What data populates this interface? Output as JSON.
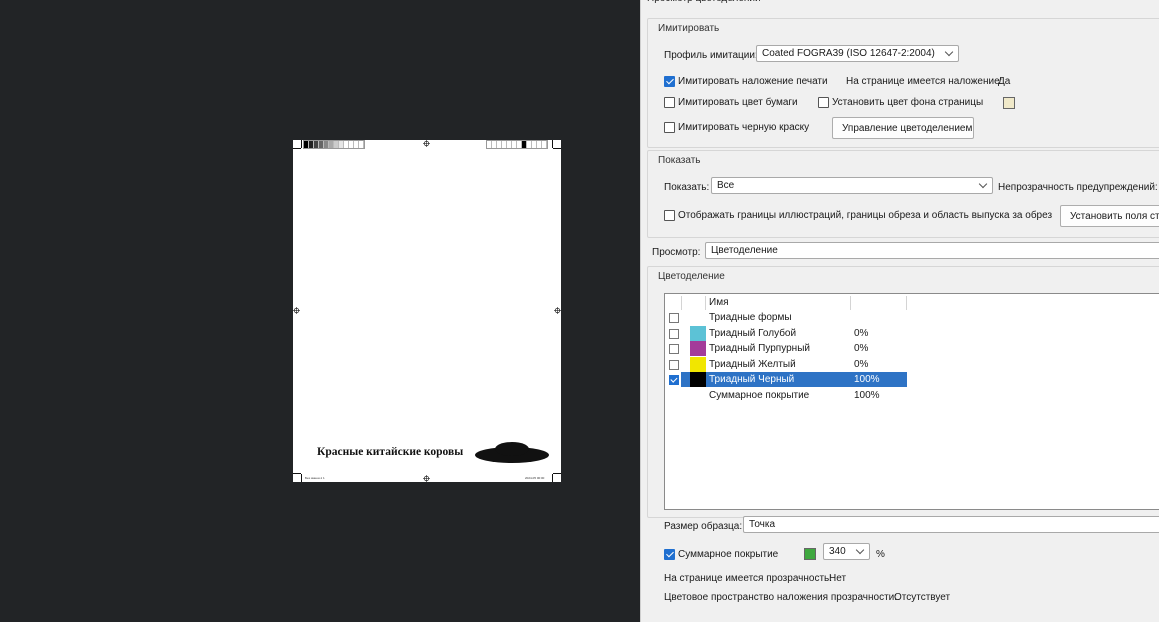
{
  "dialog": {
    "title": "Просмотр цветоделений"
  },
  "document": {
    "title": "Красные китайские коровы",
    "slug_left": "Без имени-1 1",
    "slug_right": "2024-05 00:00"
  },
  "simulate": {
    "group_title": "Имитировать",
    "profile_label": "Профиль имитации:",
    "profile_value": "Coated FOGRA39 (ISO 12647-2:2004)",
    "overprint_label": "Имитировать наложение печати",
    "overprint_checked": true,
    "page_overprint_label": "На странице имеется наложение:",
    "page_overprint_value": "Да",
    "paper_color_label": "Имитировать цвет бумаги",
    "page_bg_label": "Установить цвет фона страницы",
    "page_bg_color": "#f0e9c9",
    "black_ink_label": "Имитировать черную краску",
    "ink_manager_button": "Управление цветоделением"
  },
  "show": {
    "group_title": "Показать",
    "show_label": "Показать:",
    "show_value": "Все",
    "warning_opacity_label": "Непрозрачность предупреждений:",
    "boxes_label": "Отображать границы иллюстраций, границы обреза и область выпуска за обрез",
    "set_margins_button": "Установить поля страницы"
  },
  "preview": {
    "label": "Просмотр:",
    "value": "Цветоделение"
  },
  "separations": {
    "group_title": "Цветоделение",
    "column_name": "Имя",
    "rows": [
      {
        "name": "Триадные формы",
        "percent": "",
        "color": "",
        "checked": false
      },
      {
        "name": "Триадный Голубой",
        "percent": "0%",
        "color": "#5cc2d6",
        "checked": false
      },
      {
        "name": "Триадный Пурпурный",
        "percent": "0%",
        "color": "#a33c9a",
        "checked": false
      },
      {
        "name": "Триадный Желтый",
        "percent": "0%",
        "color": "#f1e600",
        "checked": false
      },
      {
        "name": "Триадный Черный",
        "percent": "100%",
        "color": "#000000",
        "checked": true,
        "selected": true
      },
      {
        "name": "Суммарное покрытие",
        "percent": "100%",
        "color": "",
        "checked": false
      }
    ]
  },
  "sample": {
    "label": "Размер образца:",
    "value": "Точка"
  },
  "total_coverage": {
    "label": "Суммарное покрытие",
    "checked": true,
    "color": "#3fa83f",
    "value": "340",
    "unit": "%"
  },
  "transparency": {
    "label": "На странице имеется прозрачность:",
    "value": "Нет",
    "blend_space_label": "Цветовое пространство наложения прозрачности:",
    "blend_space_value": "Отсутствует"
  }
}
